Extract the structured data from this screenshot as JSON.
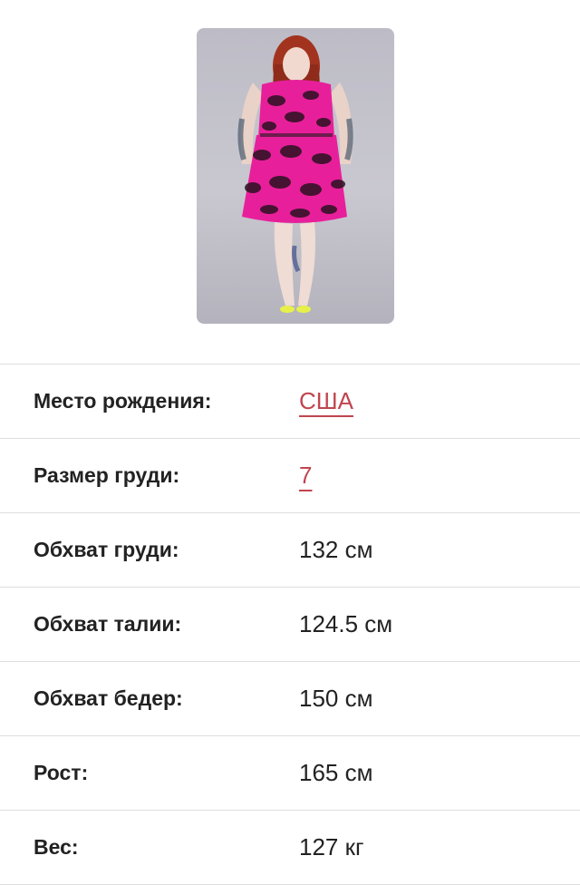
{
  "profile": {
    "photo_alt": "model-photo",
    "attributes": [
      {
        "label": "Место рождения:",
        "value": "США",
        "is_link": true
      },
      {
        "label": "Размер груди:",
        "value": "7",
        "is_link": true
      },
      {
        "label": "Обхват груди:",
        "value": "132 см",
        "is_link": false
      },
      {
        "label": "Обхват талии:",
        "value": "124.5 см",
        "is_link": false
      },
      {
        "label": "Обхват бедер:",
        "value": "150 см",
        "is_link": false
      },
      {
        "label": "Рост:",
        "value": "165 см",
        "is_link": false
      },
      {
        "label": "Вес:",
        "value": "127 кг",
        "is_link": false
      }
    ]
  },
  "colors": {
    "link": "#c0454f",
    "divider": "#dedede",
    "text": "#222222"
  }
}
